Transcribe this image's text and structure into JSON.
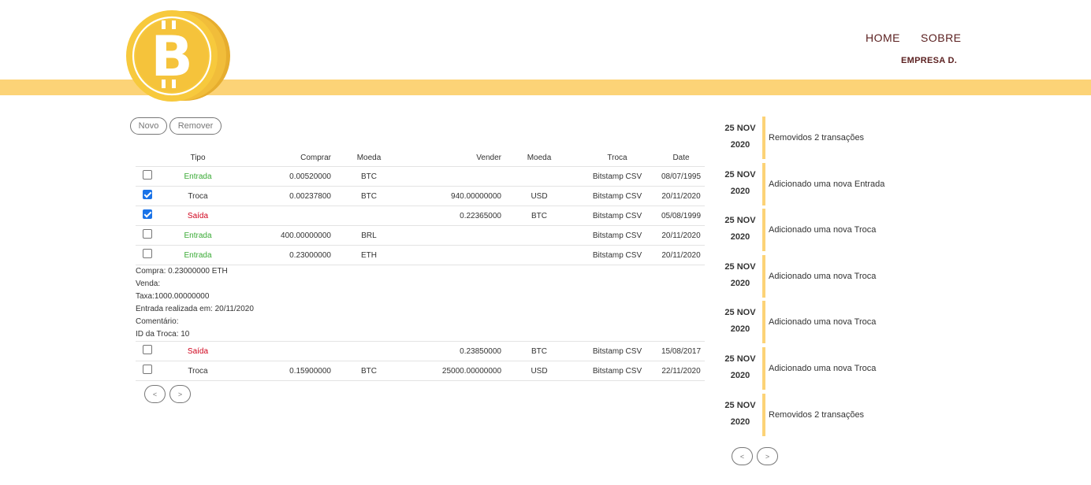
{
  "header": {
    "nav": {
      "home": "HOME",
      "sobre": "SOBRE"
    },
    "company": "EMPRESA D.",
    "logo_symbol": "B",
    "colors": {
      "band": "#fcd377",
      "coin": "#f5c33b",
      "nav": "#5a1f1f"
    }
  },
  "toolbar": {
    "novo_label": "Novo",
    "remover_label": "Remover"
  },
  "table": {
    "headers": {
      "tipo": "Tipo",
      "comprar": "Comprar",
      "moeda1": "Moeda",
      "vender": "Vender",
      "moeda2": "Moeda",
      "troca": "Troca",
      "date": "Date"
    },
    "rows": [
      {
        "checked": false,
        "tipo": "Entrada",
        "comprar": "0.00520000",
        "moeda1": "BTC",
        "vender": "",
        "moeda2": "",
        "troca": "Bitstamp CSV",
        "date": "08/07/1995"
      },
      {
        "checked": true,
        "tipo": "Troca",
        "comprar": "0.00237800",
        "moeda1": "BTC",
        "vender": "940.00000000",
        "moeda2": "USD",
        "troca": "Bitstamp CSV",
        "date": "20/11/2020"
      },
      {
        "checked": true,
        "tipo": "Saída",
        "comprar": "",
        "moeda1": "",
        "vender": "0.22365000",
        "moeda2": "BTC",
        "troca": "Bitstamp CSV",
        "date": "05/08/1999"
      },
      {
        "checked": false,
        "tipo": "Entrada",
        "comprar": "400.00000000",
        "moeda1": "BRL",
        "vender": "",
        "moeda2": "",
        "troca": "Bitstamp CSV",
        "date": "20/11/2020"
      },
      {
        "checked": false,
        "tipo": "Entrada",
        "comprar": "0.23000000",
        "moeda1": "ETH",
        "vender": "",
        "moeda2": "",
        "troca": "Bitstamp CSV",
        "date": "20/11/2020"
      },
      {
        "checked": false,
        "tipo": "Saída",
        "comprar": "",
        "moeda1": "",
        "vender": "0.23850000",
        "moeda2": "BTC",
        "troca": "Bitstamp CSV",
        "date": "15/08/2017"
      },
      {
        "checked": false,
        "tipo": "Troca",
        "comprar": "0.15900000",
        "moeda1": "BTC",
        "vender": "25000.00000000",
        "moeda2": "USD",
        "troca": "Bitstamp CSV",
        "date": "22/11/2020"
      }
    ],
    "details": {
      "compra": "Compra: 0.23000000 ETH",
      "venda": "Venda:",
      "taxa": "Taxa:1000.00000000",
      "entrada": "Entrada realizada em: 20/11/2020",
      "comentario": "Comentário:",
      "id_troca": "ID da Troca: 10"
    },
    "pagination": {
      "prev": "<",
      "next": ">"
    }
  },
  "timeline": {
    "items": [
      {
        "date1": "25 NOV",
        "date2": "2020",
        "text": "Removidos 2 transações"
      },
      {
        "date1": "25 NOV",
        "date2": "2020",
        "text": "Adicionado uma nova Entrada"
      },
      {
        "date1": "25 NOV",
        "date2": "2020",
        "text": "Adicionado uma nova Troca"
      },
      {
        "date1": "25 NOV",
        "date2": "2020",
        "text": "Adicionado uma nova Troca"
      },
      {
        "date1": "25 NOV",
        "date2": "2020",
        "text": "Adicionado uma nova Troca"
      },
      {
        "date1": "25 NOV",
        "date2": "2020",
        "text": "Adicionado uma nova Troca"
      },
      {
        "date1": "25 NOV",
        "date2": "2020",
        "text": "Removidos 2 transações"
      }
    ],
    "pagination": {
      "prev": "<",
      "next": ">"
    }
  }
}
